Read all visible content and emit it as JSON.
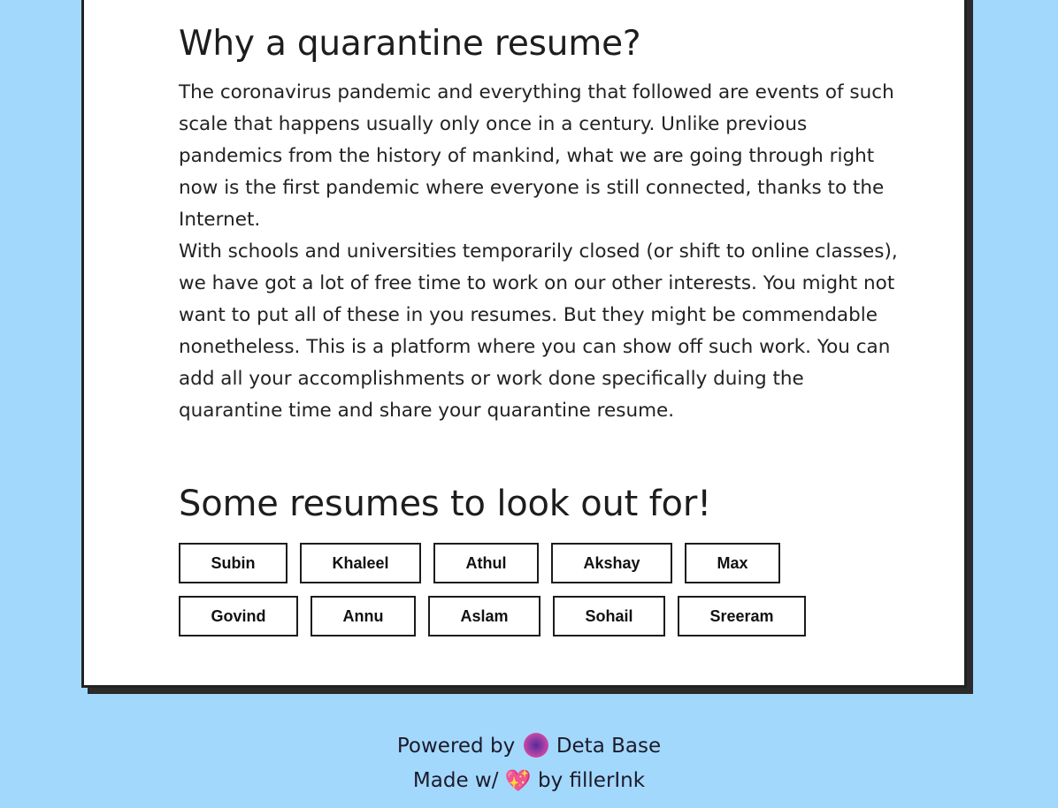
{
  "section1": {
    "title": "Why a quarantine resume?",
    "paragraph1": "The coronavirus pandemic and everything that followed are events of such scale that happens usually only once in a century. Unlike previous pandemics from the history of mankind, what we are going through right now is the first pandemic where everyone is still connected, thanks to the Internet.",
    "paragraph2": "With schools and universities temporarily closed (or shift to online classes), we have got a lot of free time to work on our other interests. You might not want to put all of these in you resumes. But they might be commendable nonetheless. This is a platform where you can show off such work. You can add all your accomplishments or work done specifically duing the quarantine time and share your quarantine resume."
  },
  "section2": {
    "title": "Some resumes to look out for!",
    "row1": [
      "Subin",
      "Khaleel",
      "Athul",
      "Akshay",
      "Max"
    ],
    "row2": [
      "Govind",
      "Annu",
      "Aslam",
      "Sohail",
      "Sreeram"
    ]
  },
  "footer": {
    "powered_prefix": "Powered by",
    "powered_name": "Deta Base",
    "made_prefix": "Made w/",
    "made_suffix": "by fillerInk",
    "heart_icon": "sparkling-heart-icon",
    "deta_icon": "deta-logo-icon"
  },
  "colors": {
    "background": "#a3d8fd",
    "card": "#ffffff",
    "border": "#222222"
  }
}
